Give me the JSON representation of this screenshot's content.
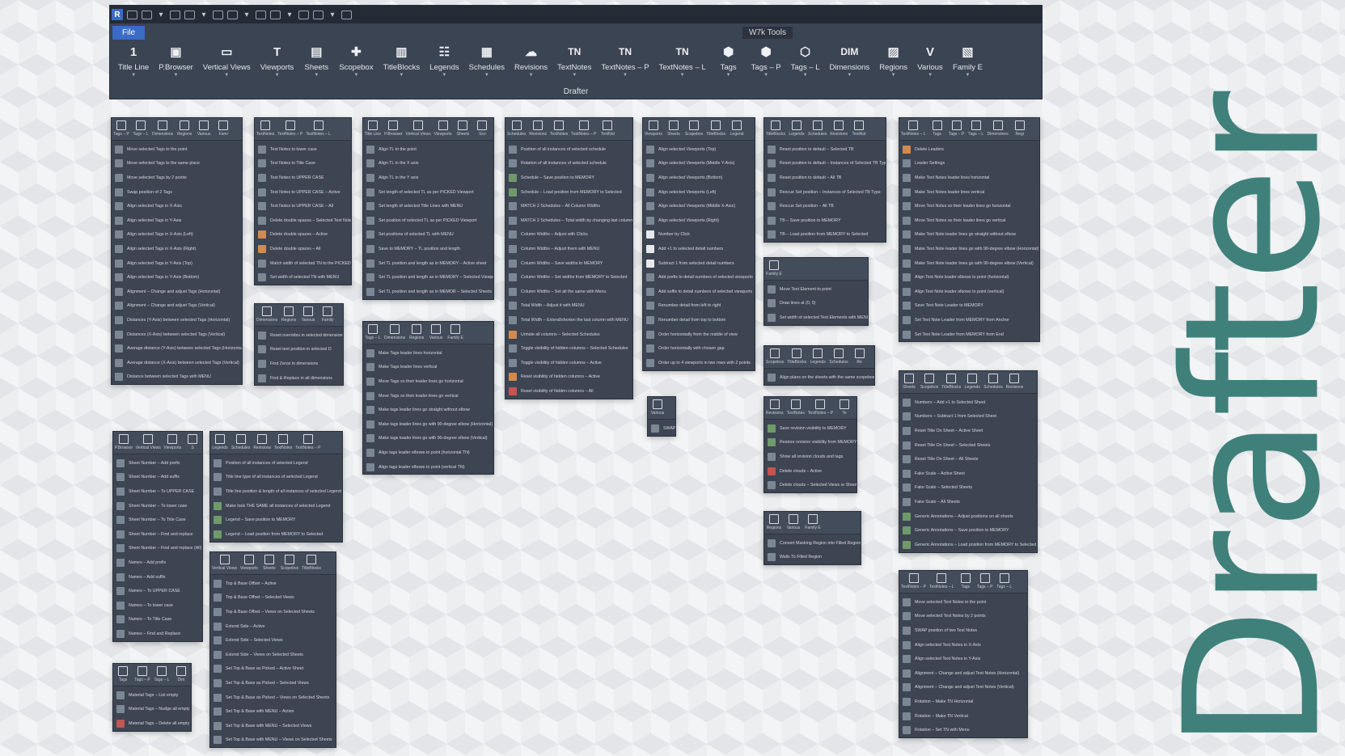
{
  "ribbon": {
    "file_tab": "File",
    "context_tab": "W7k Tools",
    "panel_title": "Drafter",
    "qat_icons": [
      "app-logo-icon",
      "new-icon",
      "open-icon",
      "save-icon",
      "sync-icon",
      "undo-icon",
      "redo-icon",
      "print-icon",
      "close-icon",
      "measure-icon",
      "dimension-icon",
      "tag-icon",
      "text-icon",
      "home-icon",
      "sections-icon",
      "switch-window-icon",
      "customize-icon"
    ],
    "tools": [
      {
        "label": "Title Line",
        "glyph": "1"
      },
      {
        "label": "P.Browser",
        "glyph": "▣"
      },
      {
        "label": "Vertical Views",
        "glyph": "▭"
      },
      {
        "label": "Viewports",
        "glyph": "T"
      },
      {
        "label": "Sheets",
        "glyph": "▤"
      },
      {
        "label": "Scopebox",
        "glyph": "✚"
      },
      {
        "label": "TitleBlocks",
        "glyph": "▥"
      },
      {
        "label": "Legends",
        "glyph": "☷"
      },
      {
        "label": "Schedules",
        "glyph": "▦"
      },
      {
        "label": "Revisions",
        "glyph": "☁"
      },
      {
        "label": "TextNotes",
        "glyph": "TN"
      },
      {
        "label": "TextNotes – P",
        "glyph": "TN"
      },
      {
        "label": "TextNotes – L",
        "glyph": "TN"
      },
      {
        "label": "Tags",
        "glyph": "⬢"
      },
      {
        "label": "Tags – P",
        "glyph": "⬢"
      },
      {
        "label": "Tags – L",
        "glyph": "⬡"
      },
      {
        "label": "Dimensions",
        "glyph": "DIM"
      },
      {
        "label": "Regions",
        "glyph": "▨"
      },
      {
        "label": "Various",
        "glyph": "V"
      },
      {
        "label": "Family E",
        "glyph": "▧"
      }
    ]
  },
  "drafter_title": "Drafter",
  "panels": [
    {
      "id": "tags",
      "head": [
        "Tags – P",
        "Tags – L",
        "Dimensions",
        "Regions",
        "Various",
        "Fami"
      ],
      "items": [
        "Move selected Tags to the point",
        "Move selected Tags to the same place",
        "Move selected Tags by 2 points",
        "Swap position of 2 Tags",
        "Align selected Tags in X-Axis",
        "Align selected Tags in Y-Axis",
        "Align selected Tags in X-Axis (Left)",
        "Align selected Tags in X-Axis (Right)",
        "Align selected Tags in Y-Axis (Top)",
        "Align selected Tags in Y-Axis (Bottom)",
        "Alignment – Change and adjust Tags (Horizontal)",
        "Alignment – Change and adjust Tags (Vertical)",
        "Distances (Y-Axis) between selected Tags (Horizontal)",
        "Distances (X-Axis) between selected Tags (Vertical)",
        "Average distance (Y-Axis) between selected Tags (Horizontal)",
        "Average distance (X-Axis) between selected Tags (Vertical)",
        "Distance between selected Tags with MENU"
      ]
    },
    {
      "id": "textnotes",
      "head": [
        "TextNotes",
        "TextNotes – P",
        "TextNotes – L"
      ],
      "items": [
        "Text Notes to lower case",
        "Text Notes to Title Case",
        "Text Notes to UPPER CASE",
        "Text Notes to UPPER CASE – Active",
        "Text Notes to UPPER CASE – All",
        "Delete double spaces – Selected Text Notes",
        "Delete double spaces – Active",
        "Delete double spaces – All",
        "Match width of selected TN to the PICKED",
        "Set width of selected TN with MENU"
      ]
    },
    {
      "id": "dimensions",
      "head": [
        "Dimensions",
        "Regions",
        "Various",
        "Family"
      ],
      "items": [
        "Reset overrides in selected dimensions",
        "Reset text position in selected D",
        "Find Zeros in dimensions",
        "Find & Replace in all dimensions"
      ]
    },
    {
      "id": "titleline",
      "head": [
        "Title Line",
        "P.Browser",
        "Vertical Views",
        "Viewports",
        "Sheets",
        "Sco"
      ],
      "items": [
        "Align TL to the point",
        "Align TL in the X axis",
        "Align TL in the Y axis",
        "Set length of selected TL as per PICKED Viewport",
        "Set length of selected Title Lines with MENU",
        "Set position of selected TL as per PICKED Viewport",
        "Set positions of selected TL with MENU",
        "Save to MEMORY – TL position and length",
        "Set TL position and length as in MEMORY – Active sheet",
        "Set TL position and length as in MEMORY – Selected Viewports",
        "Set TL position and length as in MEMOR – Selected Sheets"
      ]
    },
    {
      "id": "tagsl",
      "head": [
        "Tags – L",
        "Dimensions",
        "Regions",
        "Various",
        "Family E"
      ],
      "items": [
        "Make Tags leader lines horizontal",
        "Make Tags leader lines vertical",
        "Move Tags so their leader lines go horizontal",
        "Move Tags so their leader lines go vertical",
        "Make tags leader lines go straight without elbow",
        "Make tags leader lines go with 90-degree elbow (Horizontal)",
        "Make tags leader lines go with 90-degree elbow (Vertical)",
        "Align tags leader elbows to point (horizontal TN)",
        "Align tags leader elbows to point (vertical TN)"
      ]
    },
    {
      "id": "schedules",
      "head": [
        "Schedules",
        "Revisions",
        "TextNotes",
        "TextNotes – P",
        "TextNot"
      ],
      "items": [
        "Position of all instances of selected schedule",
        "Rotation of all instances of selected schedule",
        "Schedule – Save position to MEMORY",
        "Schedule – Load position from MEMORY to Selected",
        "MATCH 2 Schedules – All Column Widths",
        "MATCH 2 Schedules – Total width by changing last column",
        "Column Widths – Adjust with Clicks",
        "Column Widths – Adjust them with MENU",
        "Column Widths – Save widths to MEMORY",
        "Column Widths – Set widths from MEMORY to Selected",
        "Column Widths – Set all the same with Menu",
        "Total Width – Adjust it with MENU",
        "Total Width – Extend/shorten the last column with MENU",
        "Unhide all columns – Selected Schedules",
        "Toggle visibility of hidden columns – Selected Schedules",
        "Toggle visibility of hidden columns – Active",
        "Reset visibility of hidden columns – Active",
        "Reset visibility of hidden columns – All"
      ]
    },
    {
      "id": "viewports",
      "head": [
        "Viewports",
        "Sheets",
        "Scopebox",
        "TitleBlocks",
        "Legend"
      ],
      "items": [
        "Align selected Viewports (Top)",
        "Align selected Viewports (Middle Y-Axis)",
        "Align selected Viewports (Bottom)",
        "Align selected Viewports (Left)",
        "Align selected Viewports (Middle X-Axis)",
        "Align selected Viewports (Right)",
        "Number by Click",
        "Add +1 to selected detail numbers",
        "Subtract 1 from selected detail numbers",
        "Add prefix to detail numbers of selected viewports",
        "Add suffix to detail numbers of selected viewports",
        "Renumber detail from left to right",
        "Renumber detail from top to bottom",
        "Order horizontally from the middle of view",
        "Order horizontally with chosen gap",
        "Order up to 4 viewports in two rows with 2 points"
      ]
    },
    {
      "id": "various",
      "head": [
        "Various"
      ],
      "items": [
        "SWAP"
      ]
    },
    {
      "id": "titleblocks",
      "head": [
        "TitleBlocks",
        "Legends",
        "Schedules",
        "Revisions",
        "TextNot"
      ],
      "items": [
        "Reset position to default – Selected TB",
        "Reset position to default – Instances of Selected TB Type",
        "Reset position to default – All TB",
        "Rescue Set position – Instances of Selected TB Type",
        "Rescue Set position – All TB",
        "TB – Save position to MEMORY",
        "TB – Load position from MEMORY to Selected"
      ]
    },
    {
      "id": "familye",
      "head": [
        "Family E"
      ],
      "items": [
        "Move Text Element to point",
        "Draw lines at (0, 0)",
        "Set width of selected Text Elements with MENU"
      ]
    },
    {
      "id": "scopebox",
      "head": [
        "Scopebox",
        "TitleBlocks",
        "Legends",
        "Schedules",
        "Re"
      ],
      "items": [
        "Align plans on the sheets with the same scopebox"
      ]
    },
    {
      "id": "revisions",
      "head": [
        "Revisions",
        "TextNotes",
        "TextNotes – P",
        "Te"
      ],
      "items": [
        "Save revision visibility to MEMORY",
        "Restore revision visibility from MEMORY",
        "Show all revision clouds and tags",
        "Delete clouds – Active",
        "Delete clouds – Selected Views or Sheets"
      ]
    },
    {
      "id": "regions",
      "head": [
        "Regions",
        "Various",
        "Family E"
      ],
      "items": [
        "Convert Masking Region into Filled Region",
        "Walls To Filled Region"
      ]
    },
    {
      "id": "textnotesl",
      "head": [
        "TextNotes – L",
        "Tags",
        "Tags – P",
        "Tags – L",
        "Dimensions",
        "Regi"
      ],
      "items": [
        "Delete Leaders",
        "Leader Settings",
        "Make Text Notes leader lines horizontal",
        "Make Text Notes leader lines vertical",
        "Move Text Notes so their leader lines go horizontal",
        "Move Text Notes so their leader lines go vertical",
        "Make Text Note leader lines go straight without elbow",
        "Make Text Note leader lines go with 90-degree elbow (Horizontal)",
        "Make Text Note leader lines go with 90-degree elbow (Vertical)",
        "Align Text Note leader elbows to point (horizontal)",
        "Align Text Note leader elbows to point (vertical)",
        "Save Text Note Leader to MEMORY",
        "Set Text Note Leader from MEMORY from Anchor",
        "Set Text Note Leader from MEMORY from End"
      ]
    },
    {
      "id": "sheets",
      "head": [
        "Sheets",
        "Scopebox",
        "TitleBlocks",
        "Legends",
        "Schedules",
        "Revisions"
      ],
      "items": [
        "Numbers – Add +1 to Selected Sheet",
        "Numbers – Subtract 1 from Selected Sheet",
        "Reset Title On Sheet – Active Sheet",
        "Reset Title On Sheet – Selected Sheets",
        "Reset Title On Sheet – All Sheets",
        "Fake Scale – Active Sheet",
        "Fake Scale – Selected Sheets",
        "Fake Scale – All Sheets",
        "Generic Annotations – Adjust positions on all sheets",
        "Generic Annotations – Save position to MEMORY",
        "Generic Annotations – Load position from MEMORY to Selected"
      ]
    },
    {
      "id": "textnotesp",
      "head": [
        "TextNotes – P",
        "TextNotes – L",
        "Tags",
        "Tags – P",
        "Tags – L"
      ],
      "items": [
        "Move selected Text Notes to the point",
        "Move selected Text Notes by 2 points",
        "SWAP position of two Text Notes",
        "Align selected Text Notes in X-Axis",
        "Align selected Text Notes in Y-Axis",
        "Alignment – Change and adjust Text Notes (Horizontal)",
        "Alignment – Change and adjust Text Notes (Vertical)",
        "Rotation – Make TN Horizontal",
        "Rotation – Make TN Vertical",
        "Rotation – Set TN with Menu"
      ]
    },
    {
      "id": "pbrowser",
      "head": [
        "P.Browser",
        "Vertical Views",
        "Viewports",
        "S"
      ],
      "items": [
        "Sheet Number – Add prefix",
        "Sheet Number – Add suffix",
        "Sheet Number – To UPPER CASE",
        "Sheet Number – To lower case",
        "Sheet Number – To Title Case",
        "Sheet Number – Find and replace",
        "Sheet Number – Find and replace (All)",
        "Names – Add prefix",
        "Names – Add suffix",
        "Names – To UPPER CASE",
        "Names – To lower case",
        "Names – To Title Case",
        "Names – Find and Replace"
      ]
    },
    {
      "id": "legends",
      "head": [
        "Legends",
        "Schedules",
        "Revisions",
        "TextNotes",
        "TextNotes – P"
      ],
      "items": [
        "Position of all instances of selected Legend",
        "Title line type of all instances of selected Legend",
        "Title line position & length of all instances of selected Legend",
        "Make look THE SAME all instances of selected Legend",
        "Legend – Save position to MEMORY",
        "Legend – Load position from MEMORY to Selected"
      ]
    },
    {
      "id": "verticalviews",
      "head": [
        "Vertical Views",
        "Viewports",
        "Sheets",
        "Scopebox",
        "TitleBlocks"
      ],
      "items": [
        "Top & Base Offset – Active",
        "Top & Base Offset – Selected Views",
        "Top & Base Offset – Views on Selected Sheets",
        "Extend Side – Active",
        "Extend Side – Selected Views",
        "Extend Side – Views on Selected Sheets",
        "Set Top & Base as Picked – Active Sheet",
        "Set Top & Base as Picked – Selected Views",
        "Set Top & Base as Picked – Views on Selected Sheets",
        "Set Top & Base with MENU – Active",
        "Set Top & Base with MENU – Selected Views",
        "Set Top & Base with MENU – Views on Selected Sheets"
      ]
    },
    {
      "id": "material",
      "head": [
        "Tags",
        "Tags – P",
        "Tags – L",
        "Dim"
      ],
      "items": [
        "Material Tags – List empty",
        "Material Tags – Nudge all empty",
        "Material Tags – Delete all empty"
      ]
    }
  ]
}
